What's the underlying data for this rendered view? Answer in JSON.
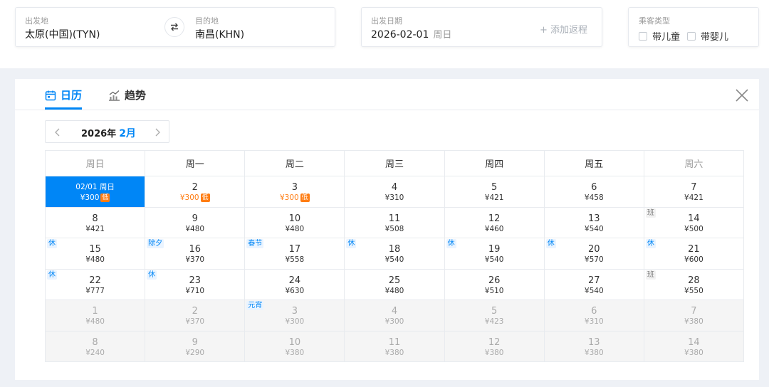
{
  "search": {
    "from_label": "出发地",
    "from_value": "太原(中国)(TYN)",
    "to_label": "目的地",
    "to_value": "南昌(KHN)",
    "date_label": "出发日期",
    "date_value": "2026-02-01",
    "date_weekday": "周日",
    "add_return": "+ 添加返程",
    "pax_label": "乘客类型",
    "pax_child": "带儿童",
    "pax_infant": "带婴儿"
  },
  "tabs": {
    "calendar": "日历",
    "trend": "趋势"
  },
  "month_nav": {
    "year": "2026年",
    "month": "2月"
  },
  "weekdays": [
    "周日",
    "周一",
    "周二",
    "周三",
    "周四",
    "周五",
    "周六"
  ],
  "low_tag": "低",
  "colors": {
    "accent": "#0086f6",
    "low_price": "#ff7d13"
  },
  "calendar": {
    "rows": [
      [
        {
          "day": "02/01 周日",
          "price": "¥300",
          "selected": true,
          "low": true
        },
        {
          "day": "2",
          "price": "¥300",
          "low": true
        },
        {
          "day": "3",
          "price": "¥300",
          "low": true
        },
        {
          "day": "4",
          "price": "¥310"
        },
        {
          "day": "5",
          "price": "¥421"
        },
        {
          "day": "6",
          "price": "¥458"
        },
        {
          "day": "7",
          "price": "¥421"
        }
      ],
      [
        {
          "day": "8",
          "price": "¥421"
        },
        {
          "day": "9",
          "price": "¥480"
        },
        {
          "day": "10",
          "price": "¥480"
        },
        {
          "day": "11",
          "price": "¥508"
        },
        {
          "day": "12",
          "price": "¥460"
        },
        {
          "day": "13",
          "price": "¥540"
        },
        {
          "day": "14",
          "price": "¥500",
          "tag": "班"
        }
      ],
      [
        {
          "day": "15",
          "price": "¥480",
          "tag": "休"
        },
        {
          "day": "16",
          "price": "¥370",
          "tag": "除夕"
        },
        {
          "day": "17",
          "price": "¥558",
          "tag": "春节"
        },
        {
          "day": "18",
          "price": "¥540",
          "tag": "休"
        },
        {
          "day": "19",
          "price": "¥540",
          "tag": "休"
        },
        {
          "day": "20",
          "price": "¥570",
          "tag": "休"
        },
        {
          "day": "21",
          "price": "¥600",
          "tag": "休"
        }
      ],
      [
        {
          "day": "22",
          "price": "¥777",
          "tag": "休"
        },
        {
          "day": "23",
          "price": "¥710",
          "tag": "休"
        },
        {
          "day": "24",
          "price": "¥630"
        },
        {
          "day": "25",
          "price": "¥480"
        },
        {
          "day": "26",
          "price": "¥510"
        },
        {
          "day": "27",
          "price": "¥540"
        },
        {
          "day": "28",
          "price": "¥550",
          "tag": "班"
        }
      ],
      [
        {
          "day": "1",
          "price": "¥480",
          "next": true
        },
        {
          "day": "2",
          "price": "¥370",
          "next": true
        },
        {
          "day": "3",
          "price": "¥300",
          "next": true,
          "tag": "元宵"
        },
        {
          "day": "4",
          "price": "¥300",
          "next": true
        },
        {
          "day": "5",
          "price": "¥423",
          "next": true
        },
        {
          "day": "6",
          "price": "¥310",
          "next": true
        },
        {
          "day": "7",
          "price": "¥380",
          "next": true
        }
      ],
      [
        {
          "day": "8",
          "price": "¥240",
          "next": true
        },
        {
          "day": "9",
          "price": "¥290",
          "next": true
        },
        {
          "day": "10",
          "price": "¥380",
          "next": true
        },
        {
          "day": "11",
          "price": "¥380",
          "next": true
        },
        {
          "day": "12",
          "price": "¥380",
          "next": true
        },
        {
          "day": "13",
          "price": "¥380",
          "next": true
        },
        {
          "day": "14",
          "price": "¥380",
          "next": true
        }
      ]
    ]
  }
}
